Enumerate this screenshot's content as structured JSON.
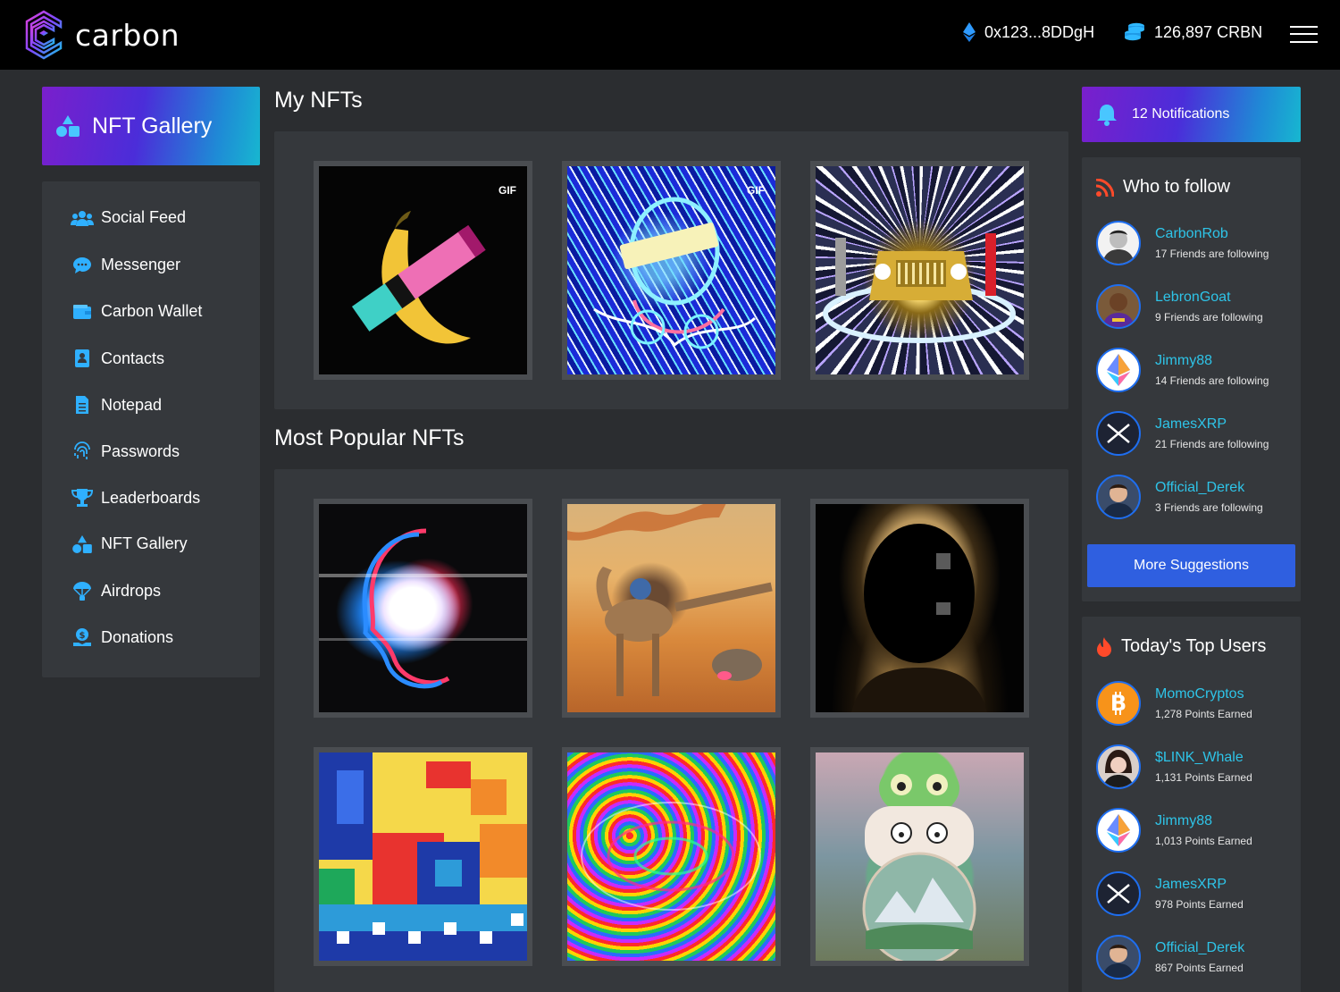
{
  "header": {
    "logo_text": "carbon",
    "wallet_address": "0x123...8DDgH",
    "balance": "126,897 CRBN"
  },
  "sidebar": {
    "active_card": "NFT Gallery",
    "items": [
      {
        "label": "Social Feed",
        "icon": "users-icon"
      },
      {
        "label": "Messenger",
        "icon": "chat-bubble-icon"
      },
      {
        "label": "Carbon Wallet",
        "icon": "wallet-icon"
      },
      {
        "label": "Contacts",
        "icon": "contacts-icon"
      },
      {
        "label": "Notepad",
        "icon": "notepad-icon"
      },
      {
        "label": "Passwords",
        "icon": "fingerprint-icon"
      },
      {
        "label": "Leaderboards",
        "icon": "trophy-icon"
      },
      {
        "label": "NFT Gallery",
        "icon": "shapes-icon"
      },
      {
        "label": "Airdrops",
        "icon": "parachute-icon"
      },
      {
        "label": "Donations",
        "icon": "donation-icon"
      }
    ]
  },
  "main": {
    "my_nfts_title": "My NFTs",
    "my_nfts": [
      {
        "art": "banana",
        "badge": "GIF"
      },
      {
        "art": "waifu",
        "badge": "GIF"
      },
      {
        "art": "car",
        "badge": ""
      }
    ],
    "popular_title": "Most Popular NFTs",
    "popular_nfts": [
      {
        "art": "face"
      },
      {
        "art": "camel"
      },
      {
        "art": "dark"
      },
      {
        "art": "pixel"
      },
      {
        "art": "psy"
      },
      {
        "art": "frog"
      }
    ]
  },
  "notifications": {
    "label": "12 Notifications"
  },
  "who_to_follow": {
    "title": "Who to follow",
    "users": [
      {
        "name": "CarbonRob",
        "sub": "17 Friends are following",
        "avatar": "photo"
      },
      {
        "name": "LebronGoat",
        "sub": "9 Friends are following",
        "avatar": "photo"
      },
      {
        "name": "Jimmy88",
        "sub": "14 Friends are following",
        "avatar": "eth"
      },
      {
        "name": "JamesXRP",
        "sub": "21 Friends are following",
        "avatar": "xrp"
      },
      {
        "name": "Official_Derek",
        "sub": "3 Friends are following",
        "avatar": "photo"
      }
    ],
    "button": "More Suggestions"
  },
  "top_users": {
    "title": "Today's Top Users",
    "users": [
      {
        "name": "MomoCryptos",
        "sub": "1,278 Points Earned",
        "avatar": "btc"
      },
      {
        "name": "$LINK_Whale",
        "sub": "1,131 Points Earned",
        "avatar": "photo"
      },
      {
        "name": "Jimmy88",
        "sub": "1,013 Points Earned",
        "avatar": "eth"
      },
      {
        "name": "JamesXRP",
        "sub": "978 Points Earned",
        "avatar": "xrp"
      },
      {
        "name": "Official_Derek",
        "sub": "867 Points Earned",
        "avatar": "photo"
      }
    ]
  },
  "colors": {
    "accent_link": "#2ec4e8",
    "button_blue": "#2f5fe0",
    "panel": "#35383c",
    "background": "#2b2d30"
  }
}
